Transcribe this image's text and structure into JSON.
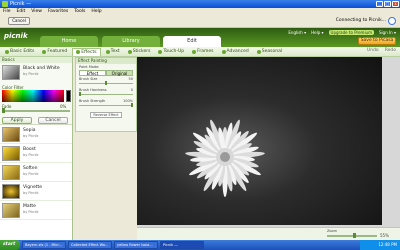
{
  "window": {
    "title": "Picnik —",
    "controls": [
      "_",
      "□",
      "x"
    ]
  },
  "menu": [
    "File",
    "Edit",
    "View",
    "Favorites",
    "Tools",
    "Help"
  ],
  "toolbar": {
    "cancel": "Cancel",
    "status": "Connecting to Picnik..."
  },
  "header": {
    "logo": "picnik",
    "tabs": [
      "Home",
      "Library",
      "Edit"
    ],
    "links": [
      "English ▾",
      "Help ▾",
      "Upgrade to Premium",
      "Sign In ▾"
    ],
    "save": "Save to Picasa"
  },
  "subtabs": [
    {
      "label": "Basic Edits",
      "active": false
    },
    {
      "label": "Featured",
      "active": false
    },
    {
      "label": "Effects",
      "active": true
    },
    {
      "label": "Text",
      "active": false
    },
    {
      "label": "Stickers",
      "active": false
    },
    {
      "label": "Touch-Up",
      "active": false
    },
    {
      "label": "Frames",
      "active": false
    },
    {
      "label": "Advanced",
      "active": false
    },
    {
      "label": "Seasonal",
      "active": false
    }
  ],
  "subright": [
    "Undo",
    "Redo"
  ],
  "left": {
    "header": "Basics",
    "selected": {
      "name": "Black and White",
      "by": "by Picnik",
      "color_label": "Color Filter",
      "fade_label": "Fade",
      "fade_value": "0%",
      "fade": 0,
      "apply": "Apply",
      "cancel": "Cancel"
    },
    "items": [
      {
        "name": "Sepia",
        "by": "by Picnik"
      },
      {
        "name": "Boost",
        "by": "by Picnik"
      },
      {
        "name": "Soften",
        "by": "by Picnik"
      },
      {
        "name": "Vignette",
        "by": "by Picnik"
      },
      {
        "name": "Matte",
        "by": "by Picnik"
      }
    ]
  },
  "settings": {
    "title": "Effect Painting",
    "paint_mode": "Paint Mode:",
    "modes": [
      "Effect",
      "Original"
    ],
    "sliders": [
      {
        "label": "Brush Size",
        "value": "50",
        "level": 0.5
      },
      {
        "label": "Brush Hardness",
        "value": "0",
        "level": 0.0
      },
      {
        "label": "Brush Strength",
        "value": "100%",
        "level": 1.0
      }
    ],
    "reverse": "Reverse Effect"
  },
  "zoom": {
    "label": "Zoom",
    "value": "55%",
    "level": 0.55
  },
  "taskbar": {
    "start": "start",
    "tasks": [
      "Bayern.xls (1 - Micr...",
      "Collected Effect Wo...",
      "yellow flower Isola...",
      "Picnik —"
    ],
    "clock": "12:48 PM"
  }
}
